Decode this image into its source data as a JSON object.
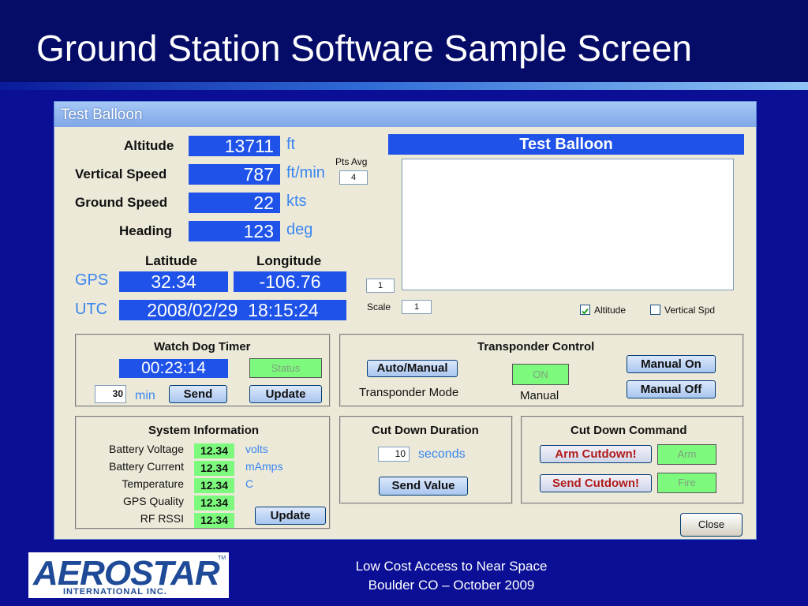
{
  "slide": {
    "title": "Ground Station Software Sample Screen",
    "footer_line1": "Low Cost Access to Near Space",
    "footer_line2": "Boulder CO – October 2009",
    "logo_main": "AEROSTAR",
    "logo_sub": "INTERNATIONAL INC.",
    "logo_tm": "TM"
  },
  "window": {
    "title": "Test Balloon",
    "close_label": "Close"
  },
  "flight": {
    "altitude": {
      "label": "Altitude",
      "value": "13711",
      "unit": "ft"
    },
    "vertical_speed": {
      "label": "Vertical Speed",
      "value": "787",
      "unit": "ft/min"
    },
    "ground_speed": {
      "label": "Ground Speed",
      "value": "22",
      "unit": "kts"
    },
    "heading": {
      "label": "Heading",
      "value": "123",
      "unit": "deg"
    },
    "pts_avg_label": "Pts Avg",
    "pts_avg_value": "4"
  },
  "gps": {
    "latitude_label": "Latitude",
    "longitude_label": "Longitude",
    "gps_label": "GPS",
    "latitude": "32.34",
    "longitude": "-106.76",
    "utc_label": "UTC",
    "utc_value": "2008/02/29  18:15:24"
  },
  "plot": {
    "header": "Test Balloon",
    "small_input_value": "1",
    "scale_label": "Scale",
    "scale_value": "1",
    "altitude_checkbox_label": "Altitude",
    "altitude_checked": true,
    "vertical_spd_checkbox_label": "Vertical Spd",
    "vertical_spd_checked": false
  },
  "watchdog": {
    "title": "Watch Dog Timer",
    "timer": "00:23:14",
    "status": "Status",
    "minutes_value": "30",
    "minutes_unit": "min",
    "send_label": "Send",
    "update_label": "Update"
  },
  "transponder": {
    "title": "Transponder Control",
    "auto_manual_label": "Auto/Manual",
    "mode_label": "Transponder Mode",
    "on_status": "ON",
    "manual_label": "Manual",
    "manual_on_label": "Manual On",
    "manual_off_label": "Manual Off"
  },
  "system": {
    "title": "System Information",
    "rows": [
      {
        "label": "Battery Voltage",
        "value": "12.34",
        "unit": "volts"
      },
      {
        "label": "Battery Current",
        "value": "12.34",
        "unit": "mAmps"
      },
      {
        "label": "Temperature",
        "value": "12.34",
        "unit": "C"
      },
      {
        "label": "GPS Quality",
        "value": "12.34",
        "unit": ""
      },
      {
        "label": "RF RSSI",
        "value": "12.34",
        "unit": ""
      }
    ],
    "update_label": "Update"
  },
  "cutdown_duration": {
    "title": "Cut Down Duration",
    "value": "10",
    "unit": "seconds",
    "send_value_label": "Send Value"
  },
  "cutdown_command": {
    "title": "Cut Down Command",
    "arm_label": "Arm Cutdown!",
    "arm_status": "Arm",
    "send_label": "Send Cutdown!",
    "fire_status": "Fire"
  }
}
